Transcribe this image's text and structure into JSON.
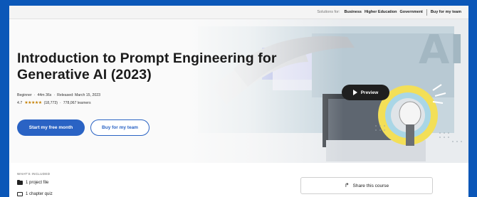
{
  "topbar": {
    "solutions_label": "Solutions for:",
    "links": [
      "Business",
      "Higher Education",
      "Government"
    ],
    "cta": "Buy for my team"
  },
  "course": {
    "title": "Introduction to Prompt Engineering for Generative AI (2023)",
    "level": "Beginner",
    "duration": "44m 36s",
    "released": "Released: March 15, 2023",
    "rating": "4.7",
    "stars": "★★★★★",
    "review_count": "(18,773)",
    "learners": "778,067 learners",
    "dot": "·"
  },
  "hero": {
    "primary_cta": "Start my free month",
    "secondary_cta": "Buy for my team",
    "preview_label": "Preview",
    "art_text": "AI"
  },
  "included": {
    "heading": "WHAT'S INCLUDED",
    "items": [
      "1 project file",
      "1 chapter quiz"
    ]
  },
  "share": {
    "label": "Share this course"
  },
  "colors": {
    "frame": "#0b57b8",
    "primary": "#2a63c4",
    "preview_bg": "#1f1f1f",
    "star": "#c47f00"
  },
  "icons": {
    "play": "play-icon",
    "share": "share-icon",
    "file": "folder-icon",
    "quiz": "quiz-icon"
  }
}
